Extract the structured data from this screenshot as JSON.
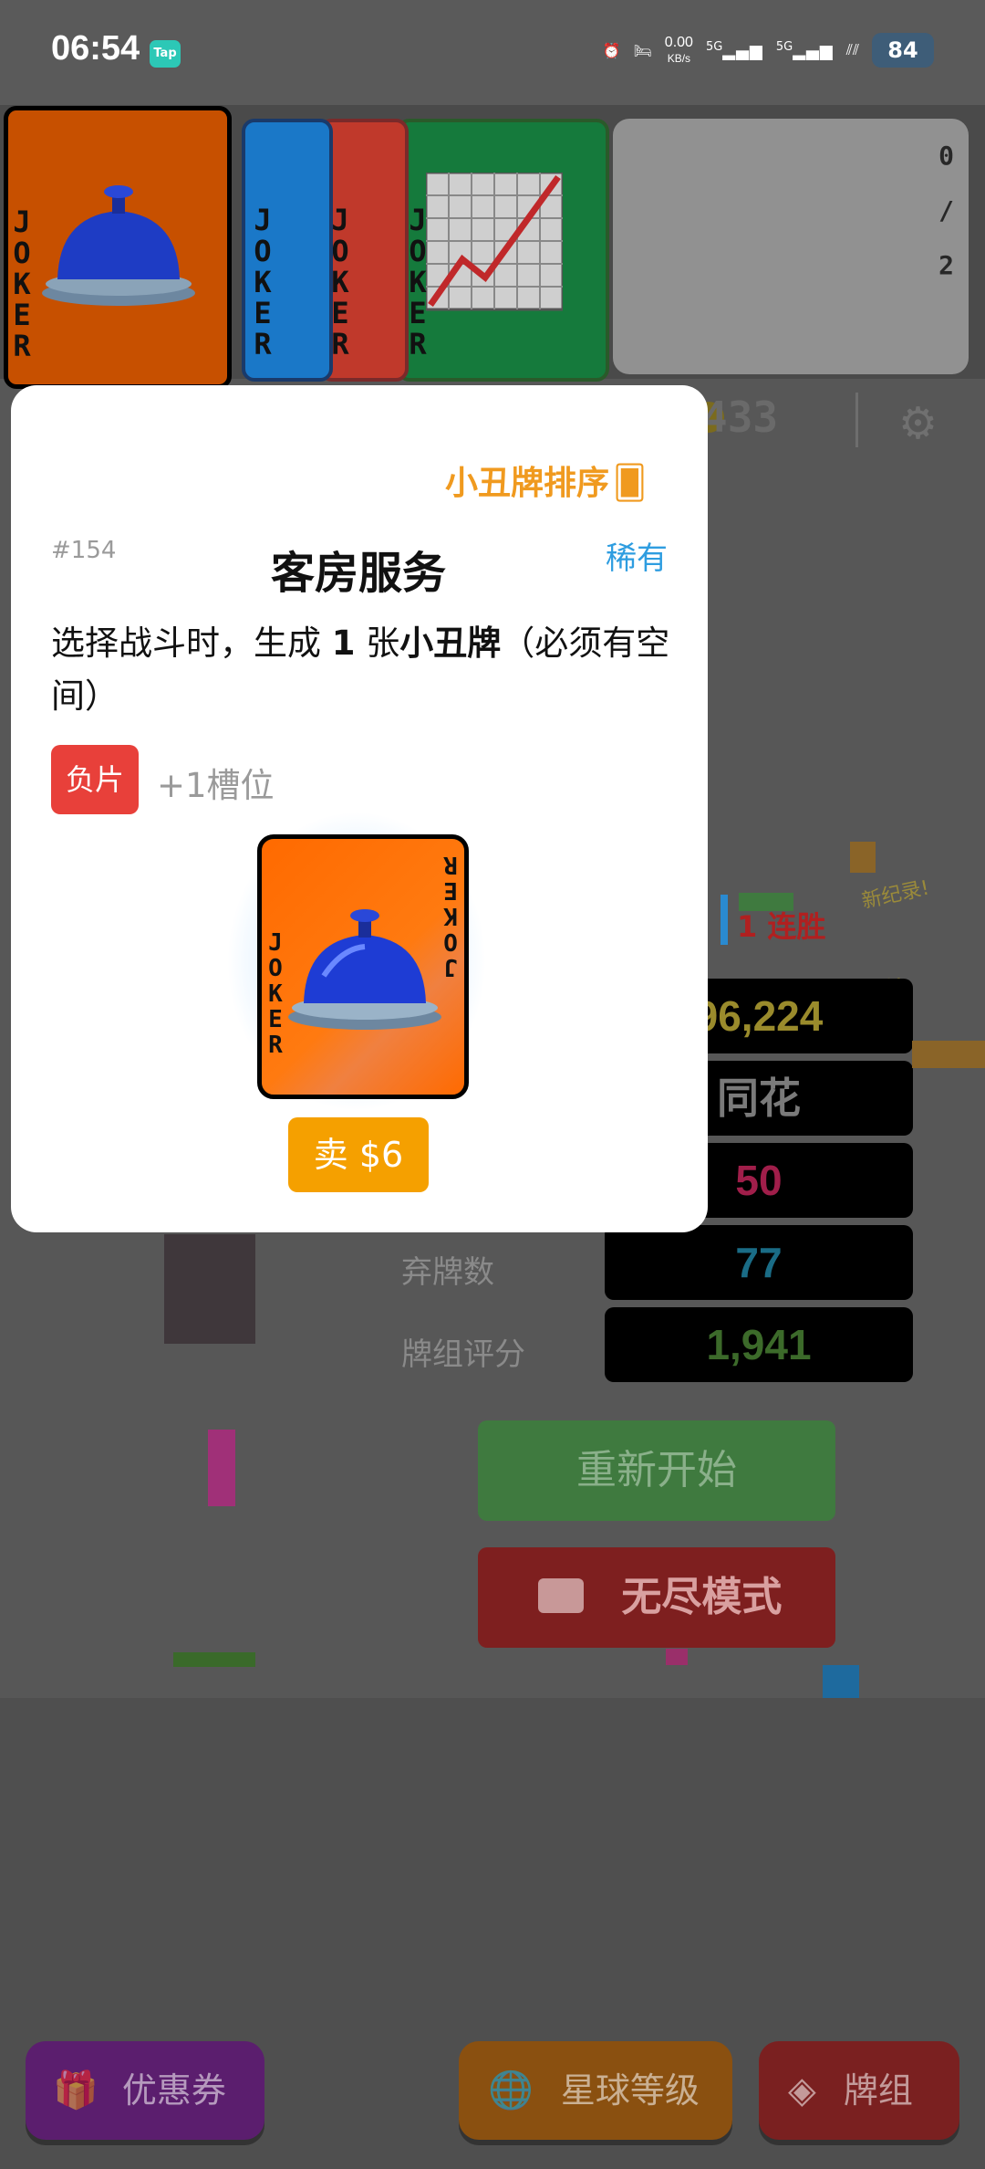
{
  "status_bar": {
    "time": "06:54",
    "tap_badge": "Tap",
    "net_speed_value": "0.00",
    "net_speed_unit": "KB/s",
    "sim1": "5G",
    "sim2": "5G",
    "battery": "84"
  },
  "jokers": {
    "card_text": "JOKER",
    "cards": [
      {
        "color": "#e85a00",
        "icon": "service-bell-icon"
      },
      {
        "color": "#1a78c8",
        "icon": "unknown-icon"
      },
      {
        "color": "#c0392b",
        "icon": "satellite-dish-icon"
      },
      {
        "color": "#157a3c",
        "icon": "chart-up-icon"
      }
    ]
  },
  "joker_slots": {
    "current": "0",
    "separator": "/",
    "max": "2"
  },
  "money": "433",
  "stats": {
    "streak": "1 连胜",
    "new_record_1": "新纪录!",
    "new_record_2": "新纪录!",
    "score": "96,224",
    "hand_type": "同花",
    "value3": "50",
    "discard_label": "弃牌数",
    "discard_value": "77",
    "deck_rating_label": "牌组评分",
    "deck_rating_value": "1,941"
  },
  "buttons": {
    "restart": "重新开始",
    "endless": "无尽模式"
  },
  "bottom_nav": {
    "coupon": "优惠券",
    "planet_level": "星球等级",
    "deck": "牌组"
  },
  "modal": {
    "sort_label": "小丑牌排序",
    "id": "#154",
    "title": "客房服务",
    "rarity": "稀有",
    "desc_part1": "选择战斗时，生成 ",
    "desc_bold1": "1",
    "desc_part2": " 张",
    "desc_bold2": "小丑牌",
    "desc_part3": "（必须有空间）",
    "edition_badge": "负片",
    "edition_effect": "+1槽位",
    "sell_button": "卖 $6"
  },
  "colors": {
    "modal_accent": "#f09a1f",
    "rarity": "#2e9de0",
    "negative_badge": "#e8403a",
    "sell_button": "#f5a000"
  }
}
